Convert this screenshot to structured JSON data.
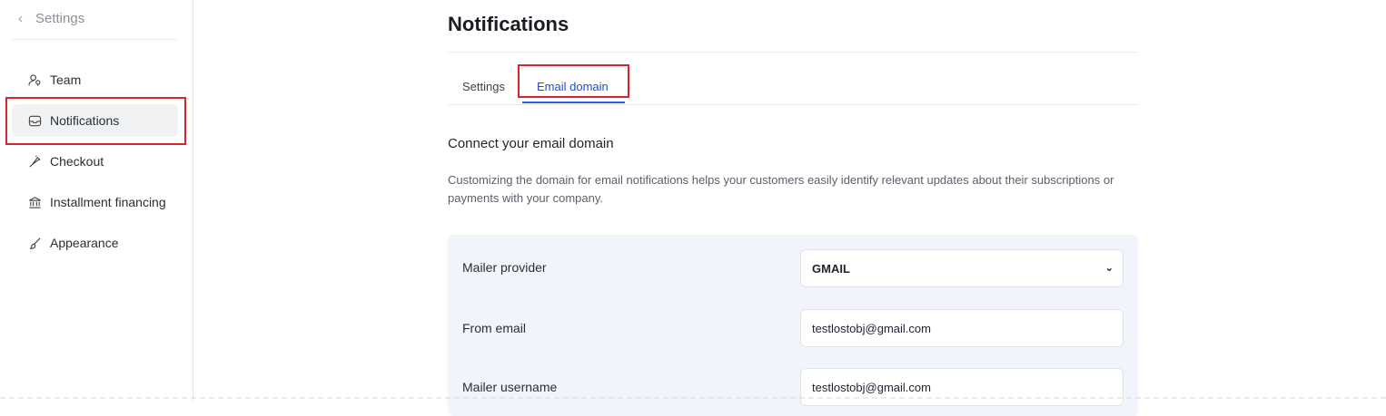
{
  "sidebar": {
    "back_label": "Settings",
    "items": [
      {
        "label": "Team",
        "icon": "team-icon"
      },
      {
        "label": "Notifications",
        "icon": "inbox-icon"
      },
      {
        "label": "Checkout",
        "icon": "checkout-icon"
      },
      {
        "label": "Installment financing",
        "icon": "bank-icon"
      },
      {
        "label": "Appearance",
        "icon": "brush-icon"
      }
    ]
  },
  "main": {
    "title": "Notifications",
    "tabs": [
      {
        "label": "Settings"
      },
      {
        "label": "Email domain",
        "active": true
      }
    ],
    "section_title": "Connect your email domain",
    "section_description": "Customizing the domain for email notifications helps your customers easily identify relevant updates about their subscriptions or payments with your company.",
    "form": {
      "mailer_provider": {
        "label": "Mailer provider",
        "value": "GMAIL"
      },
      "from_email": {
        "label": "From email",
        "value": "testlostobj@gmail.com"
      },
      "mailer_username": {
        "label": "Mailer username",
        "value": "testlostobj@gmail.com"
      }
    }
  },
  "colors": {
    "accent": "#2563eb",
    "highlight_box": "#d9262c",
    "panel_bg": "#f1f4fb"
  }
}
